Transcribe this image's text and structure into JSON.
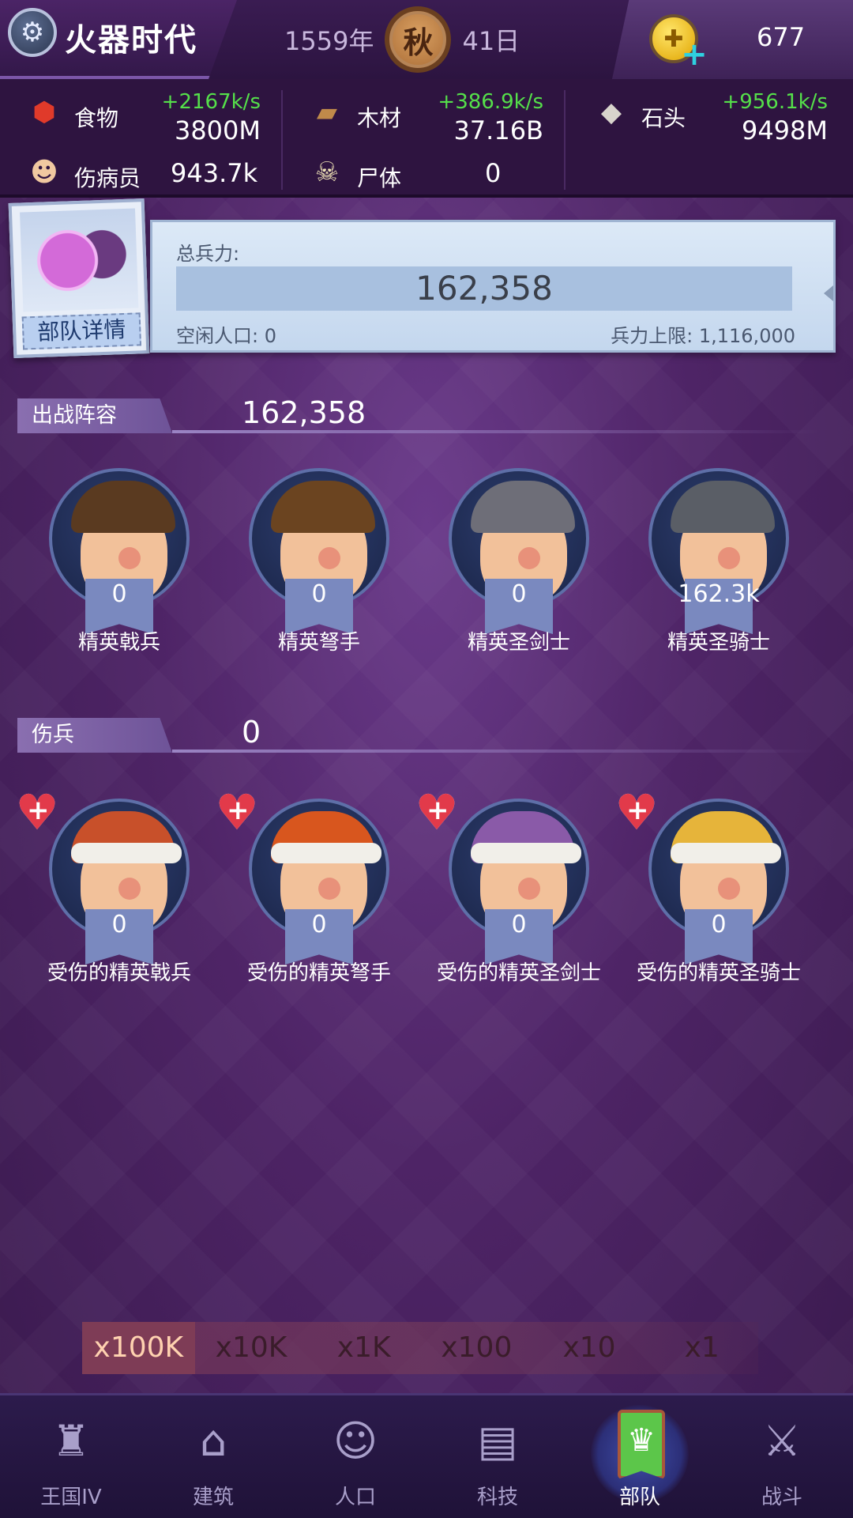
{
  "header": {
    "game_icon": "revolver-icon",
    "title": "火器时代",
    "year": "1559年",
    "season": "秋",
    "day": "41日",
    "coin_icon": "gold-coin-icon",
    "coin_value": "677"
  },
  "resources": {
    "food": {
      "icon": "meat-icon",
      "label": "食物",
      "rate": "+2167k/s",
      "amount": "3800M"
    },
    "wood": {
      "icon": "wood-logs-icon",
      "label": "木材",
      "rate": "+386.9k/s",
      "amount": "37.16B"
    },
    "stone": {
      "icon": "stone-icon",
      "label": "石头",
      "rate": "+956.1k/s",
      "amount": "9498M"
    },
    "wounded": {
      "icon": "wounded-person-icon",
      "label": "伤病员",
      "amount": "943.7k"
    },
    "corpse": {
      "icon": "corpse-icon",
      "label": "尸体",
      "amount": "0"
    }
  },
  "summary": {
    "detail_button": "部队详情",
    "total_label": "总兵力:",
    "total_value": "162,358",
    "idle_label": "空闲人口: 0",
    "cap_label": "兵力上限: 1,116,000"
  },
  "deployed": {
    "title": "出战阵容",
    "total": "162,358",
    "units": [
      {
        "name": "精英戟兵",
        "count": "0",
        "hair": "#5a3a20"
      },
      {
        "name": "精英弩手",
        "count": "0",
        "hair": "#6b4420"
      },
      {
        "name": "精英圣剑士",
        "count": "0",
        "hair": "#6e6e78"
      },
      {
        "name": "精英圣骑士",
        "count": "162.3k",
        "hair": "#5a5e66"
      }
    ]
  },
  "wounded_section": {
    "title": "伤兵",
    "total": "0",
    "units": [
      {
        "name": "受伤的精英戟兵",
        "count": "0",
        "hair": "#c8502a"
      },
      {
        "name": "受伤的精英弩手",
        "count": "0",
        "hair": "#d8561e"
      },
      {
        "name": "受伤的精英圣剑士",
        "count": "0",
        "hair": "#8a5aa8"
      },
      {
        "name": "受伤的精英圣骑士",
        "count": "0",
        "hair": "#e6b43a"
      }
    ]
  },
  "multipliers": [
    "x100K",
    "x10K",
    "x1K",
    "x100",
    "x10",
    "x1"
  ],
  "multiplier_selected": "x100K",
  "nav": [
    {
      "label": "王国IV",
      "icon": "castle-icon"
    },
    {
      "label": "建筑",
      "icon": "house-icon"
    },
    {
      "label": "人口",
      "icon": "person-icon"
    },
    {
      "label": "科技",
      "icon": "book-icon"
    },
    {
      "label": "部队",
      "icon": "army-banner-icon"
    },
    {
      "label": "战斗",
      "icon": "crossed-swords-icon"
    }
  ],
  "nav_active": "部队"
}
